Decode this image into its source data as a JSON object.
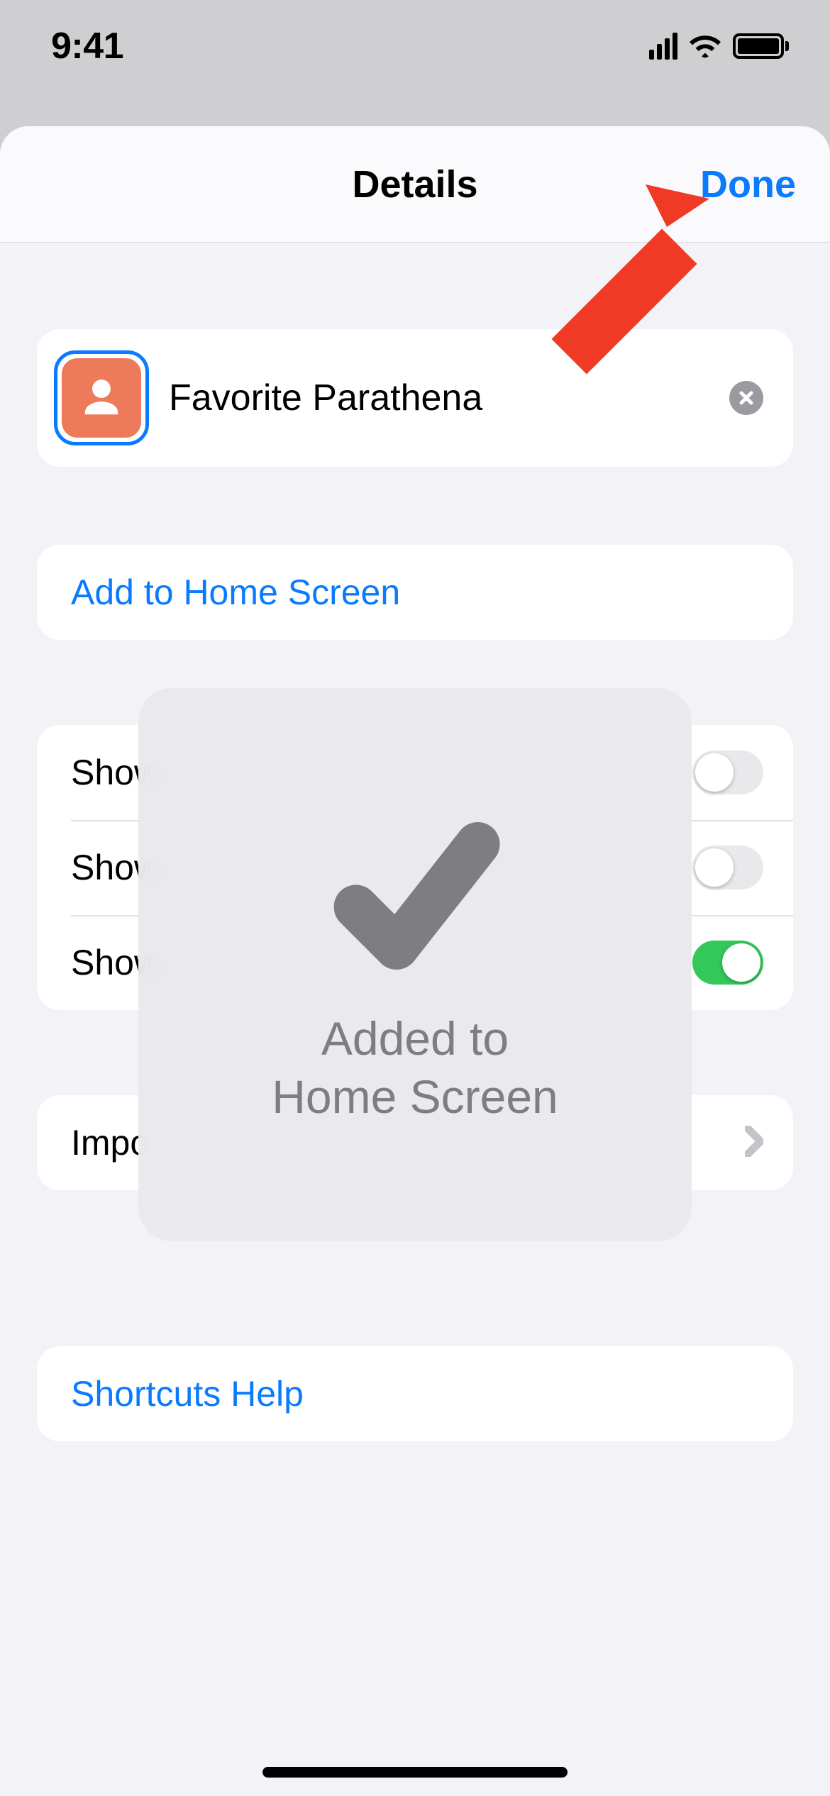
{
  "status": {
    "time": "9:41"
  },
  "sheet": {
    "title": "Details",
    "done": "Done"
  },
  "shortcut": {
    "name": "Favorite Parathena"
  },
  "actions": {
    "add_home": "Add to Home Screen",
    "help": "Shortcuts Help"
  },
  "toggles": {
    "row1": {
      "label": "Show",
      "on": false
    },
    "row2": {
      "label": "Show",
      "on": false
    },
    "row3": {
      "label": "Show",
      "on": true
    }
  },
  "import": {
    "label": "Impo"
  },
  "hud": {
    "line1": "Added to",
    "line2": "Home Screen"
  }
}
